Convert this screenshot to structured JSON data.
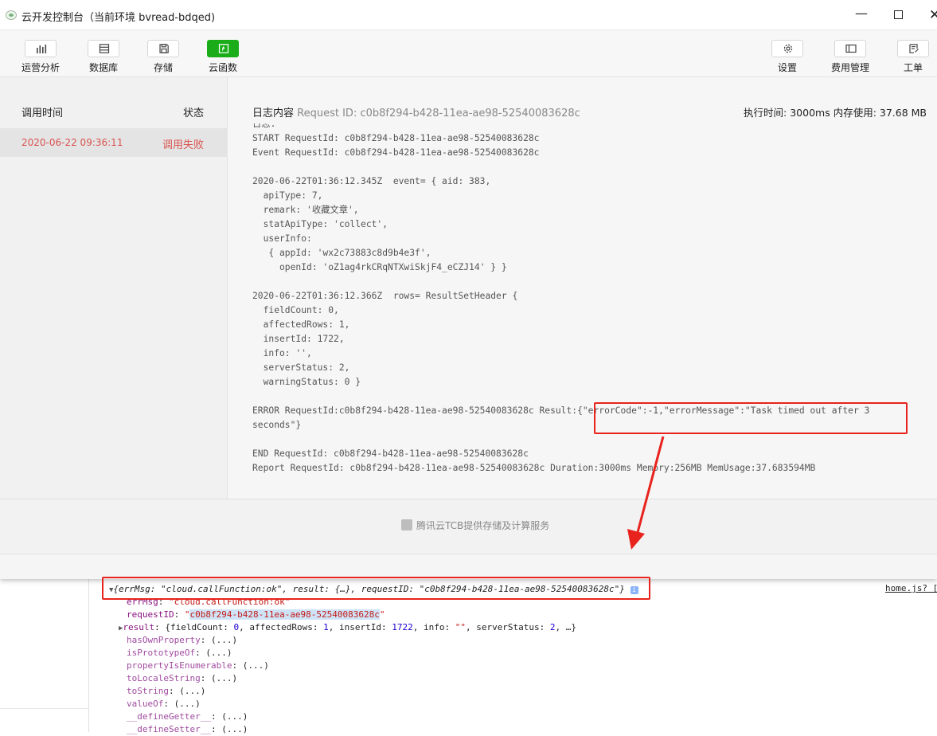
{
  "window": {
    "title": "云开发控制台（当前环境 bvread-bdqed)",
    "controls": {
      "minimize": "—",
      "close": "✕"
    }
  },
  "toolbar": {
    "left": [
      {
        "label": "运营分析",
        "icon": "bar-chart-icon"
      },
      {
        "label": "数据库",
        "icon": "database-icon"
      },
      {
        "label": "存储",
        "icon": "storage-icon"
      },
      {
        "label": "云函数",
        "icon": "cloud-function-icon",
        "active": true
      }
    ],
    "right": [
      {
        "label": "设置",
        "icon": "gear-icon"
      },
      {
        "label": "费用管理",
        "icon": "billing-icon"
      },
      {
        "label": "工单",
        "icon": "ticket-icon"
      }
    ],
    "active_color": "#1aad19"
  },
  "list": {
    "header_time": "调用时间",
    "header_status": "状态",
    "rows": [
      {
        "time": "2020-06-22 09:36:11",
        "status": "调用失败"
      }
    ],
    "error_color": "#d9534f"
  },
  "log": {
    "header_label": "日志内容",
    "request_id": "Request ID: c0b8f294-b428-11ea-ae98-52540083628c",
    "meta": "执行时间: 3000ms   内存使用: 37.68 MB",
    "text": "日志:\nSTART RequestId: c0b8f294-b428-11ea-ae98-52540083628c\nEvent RequestId: c0b8f294-b428-11ea-ae98-52540083628c\n\n2020-06-22T01:36:12.345Z  event= { aid: 383,\n  apiType: 7,\n  remark: '收藏文章',\n  statApiType: 'collect',\n  userInfo:\n   { appId: 'wx2c73883c8d9b4e3f',\n     openId: 'oZ1ag4rkCRqNTXwiSkjF4_eCZJ14' } }\n\n2020-06-22T01:36:12.366Z  rows= ResultSetHeader {\n  fieldCount: 0,\n  affectedRows: 1,\n  insertId: 1722,\n  info: '',\n  serverStatus: 2,\n  warningStatus: 0 }\n\nERROR RequestId:c0b8f294-b428-11ea-ae98-52540083628c Result:{\"errorCode\":-1,\"errorMessage\":\"Task timed out after 3\nseconds\"}\n\nEND RequestId: c0b8f294-b428-11ea-ae98-52540083628c\nReport RequestId: c0b8f294-b428-11ea-ae98-52540083628c Duration:3000ms Memory:256MB MemUsage:37.683594MB"
  },
  "footer": {
    "text": "腾讯云TCB提供存储及计算服务"
  },
  "console": {
    "source": "home.js? [",
    "summary": {
      "open": "{",
      "errMsg_key": "errMsg",
      "errMsg_val": "\"cloud.callFunction:ok\"",
      "result_key": "result",
      "result_val": "{…}",
      "requestID_key": "requestID",
      "requestID_val": "\"c0b8f294-b428-11ea-ae98-52540083628c\"",
      "close": "}",
      "badge": "i"
    },
    "errMsg": {
      "key": "errMsg",
      "value": "\"cloud.callFunction:ok\""
    },
    "requestID": {
      "key": "requestID",
      "q1": "\"",
      "value": "c0b8f294-b428-11ea-ae98-52540083628c",
      "q2": "\""
    },
    "result": {
      "key": "result",
      "fieldCount": "0",
      "affectedRows": "1",
      "insertId": "1722",
      "info": "\"\"",
      "serverStatus": "2",
      "tail": "…}"
    },
    "proto_methods": [
      "hasOwnProperty",
      "isPrototypeOf",
      "propertyIsEnumerable",
      "toLocaleString",
      "toString",
      "valueOf",
      "__defineGetter__",
      "__defineSetter__"
    ],
    "proto_value": "(...)",
    "highlight_color": "#e8231d"
  }
}
